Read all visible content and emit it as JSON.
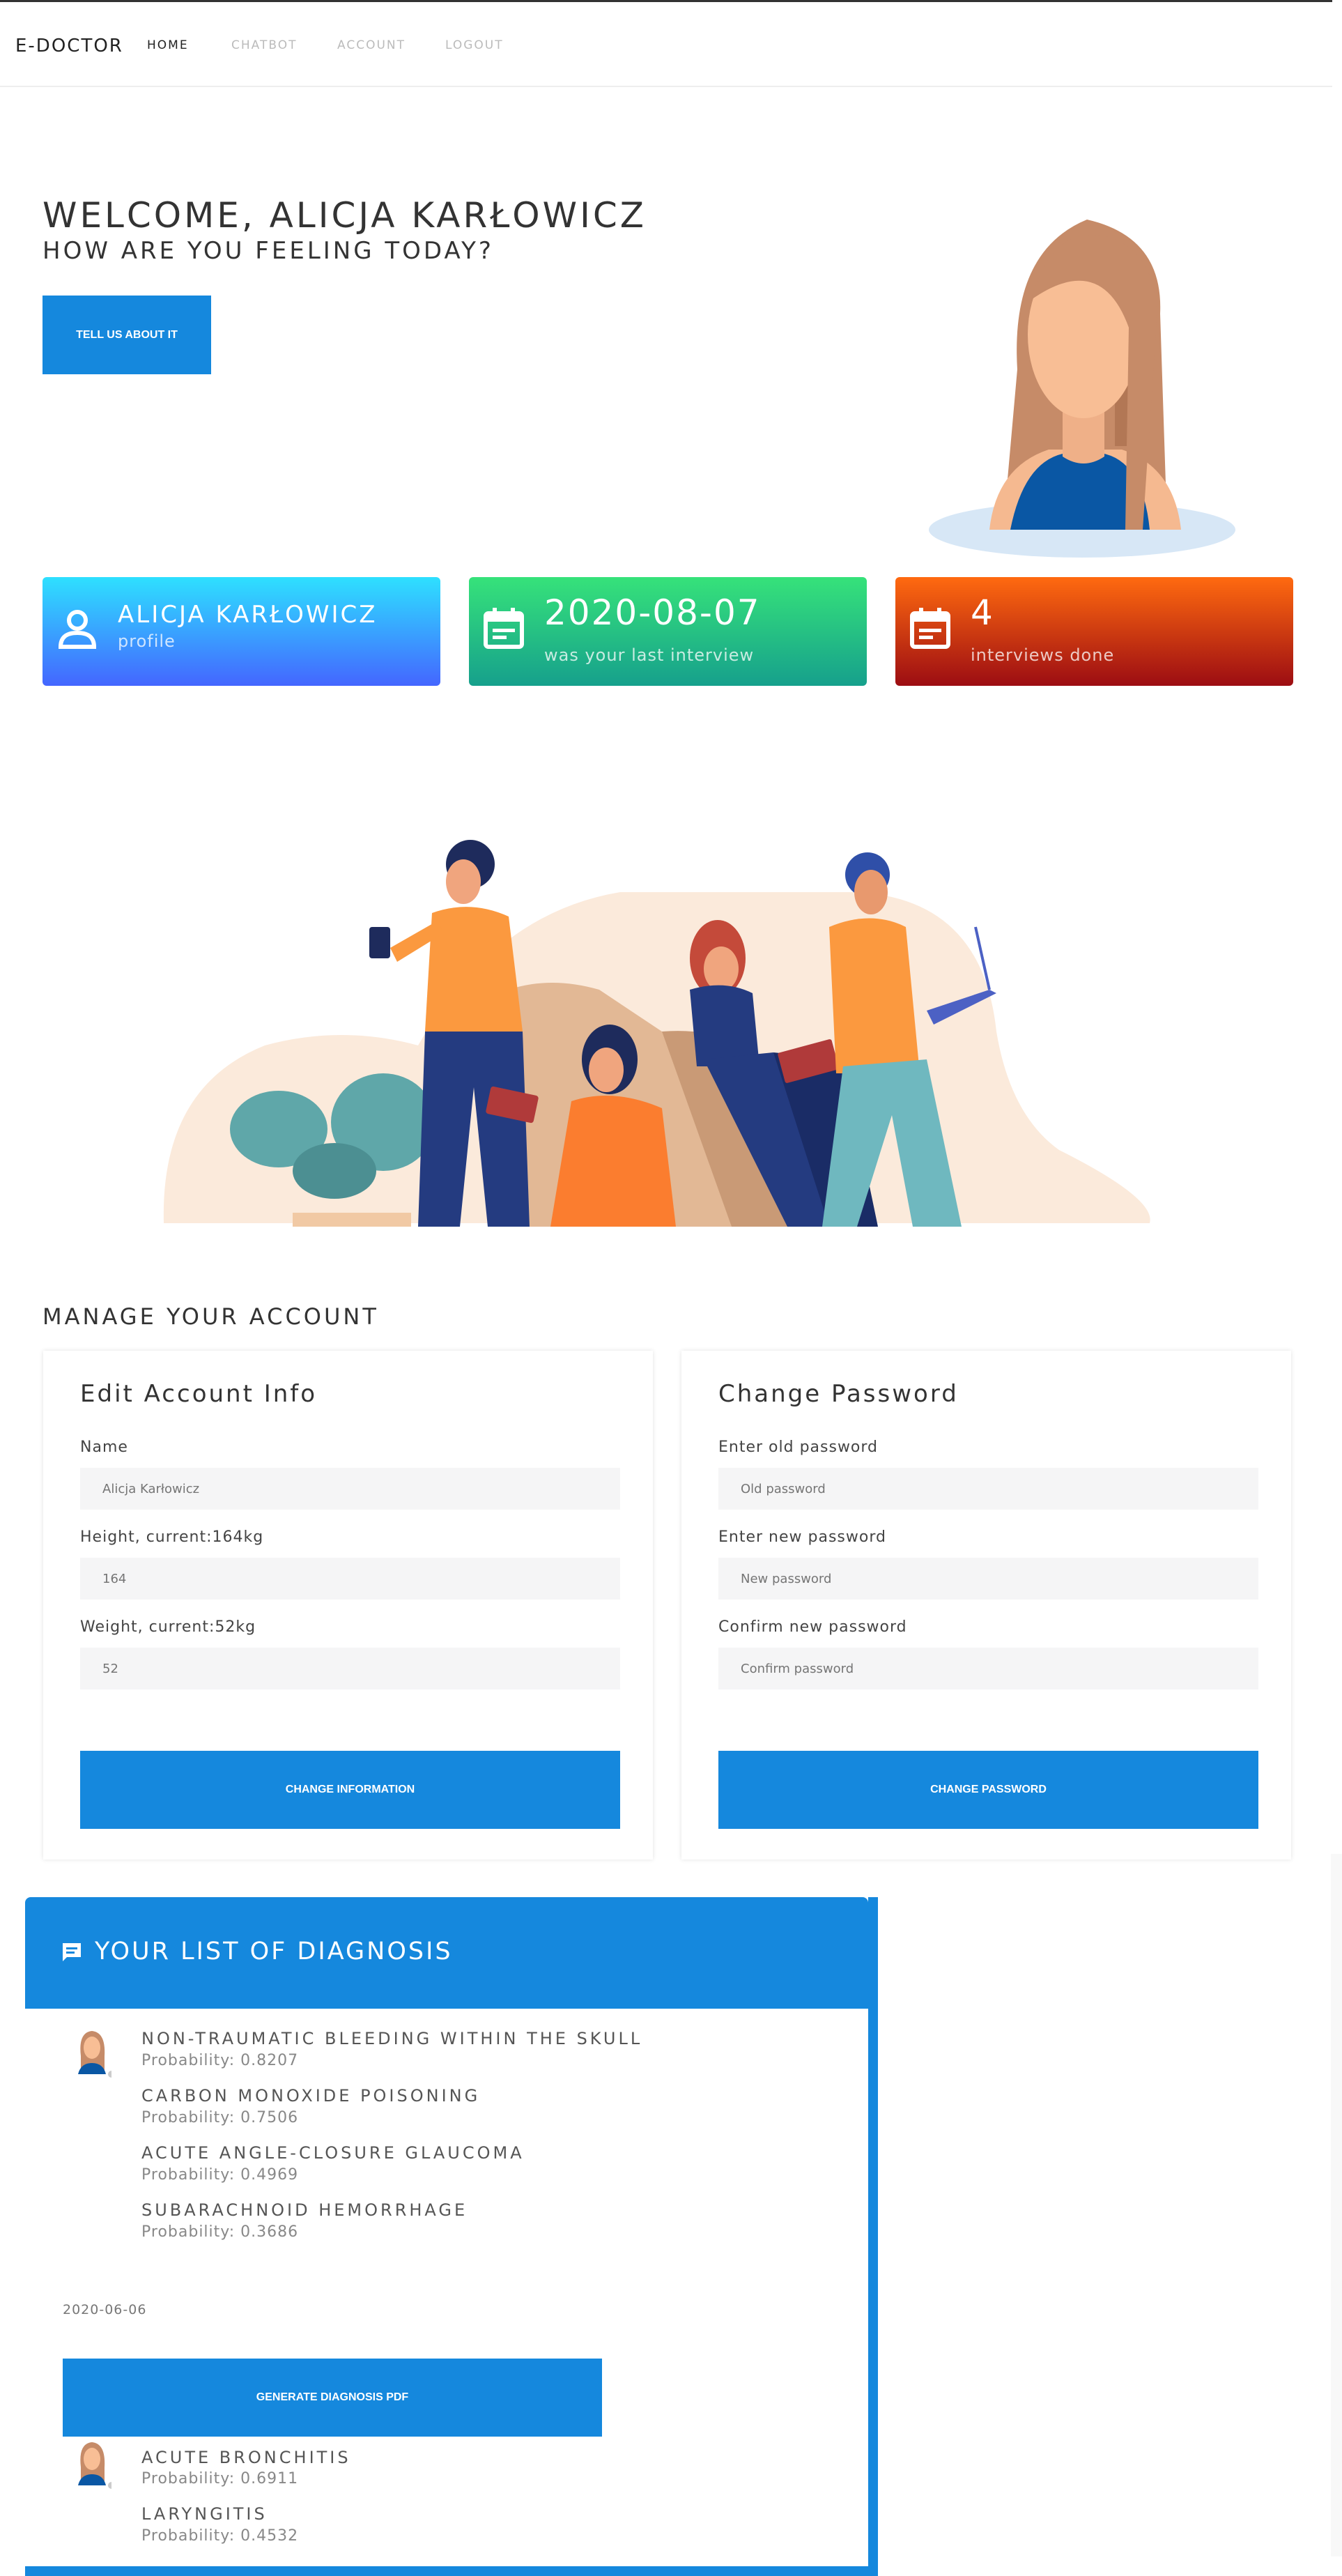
{
  "nav": {
    "brand": "E-DOCTOR",
    "links": [
      {
        "label": "HOME"
      },
      {
        "label": "CHATBOT"
      },
      {
        "label": "ACCOUNT"
      },
      {
        "label": "LOGOUT"
      }
    ]
  },
  "hero": {
    "welcome": "WELCOME, ALICJA KARŁOWICZ",
    "question": "HOW ARE YOU FEELING TODAY?",
    "button_label": "TELL US ABOUT IT"
  },
  "cards": [
    {
      "value": "ALICJA KARŁOWICZ",
      "label": "profile",
      "icon": "user-icon"
    },
    {
      "value": "2020-08-07",
      "label": "was your last interview",
      "icon": "calendar-icon"
    },
    {
      "value": "4",
      "label": "interviews done",
      "icon": "calendar-icon"
    }
  ],
  "manage": {
    "title": "MANAGE YOUR ACCOUNT",
    "edit": {
      "title": "Edit Account Info",
      "name_label": "Name",
      "name_placeholder": "Alicja Karłowicz",
      "height_label": "Height, current:164kg",
      "height_placeholder": "164",
      "weight_label": "Weight, current:52kg",
      "weight_placeholder": "52",
      "button_label": "CHANGE INFORMATION"
    },
    "password": {
      "title": "Change Password",
      "old_label": "Enter old password",
      "old_placeholder": "Old password",
      "new_label": "Enter new password",
      "new_placeholder": "New password",
      "confirm_label": "Confirm new password",
      "confirm_placeholder": "Confirm password",
      "button_label": "CHANGE PASSWORD"
    }
  },
  "diagnosis": {
    "title": "YOUR LIST OF DIAGNOSIS",
    "groups": [
      {
        "items": [
          {
            "name": "NON-TRAUMATIC BLEEDING WITHIN THE SKULL",
            "probability": "Probability: 0.8207"
          },
          {
            "name": "CARBON MONOXIDE POISONING",
            "probability": "Probability: 0.7506"
          },
          {
            "name": "ACUTE ANGLE-CLOSURE GLAUCOMA",
            "probability": "Probability: 0.4969"
          },
          {
            "name": "SUBARACHNOID HEMORRHAGE",
            "probability": "Probability: 0.3686"
          }
        ],
        "date": "2020-06-06",
        "button_label": "GENERATE DIAGNOSIS PDF"
      },
      {
        "items": [
          {
            "name": "ACUTE BRONCHITIS",
            "probability": "Probability: 0.6911"
          },
          {
            "name": "LARYNGITIS",
            "probability": "Probability: 0.4532"
          }
        ]
      }
    ]
  },
  "colors": {
    "primary": "#1588dd",
    "text": "#333333"
  }
}
